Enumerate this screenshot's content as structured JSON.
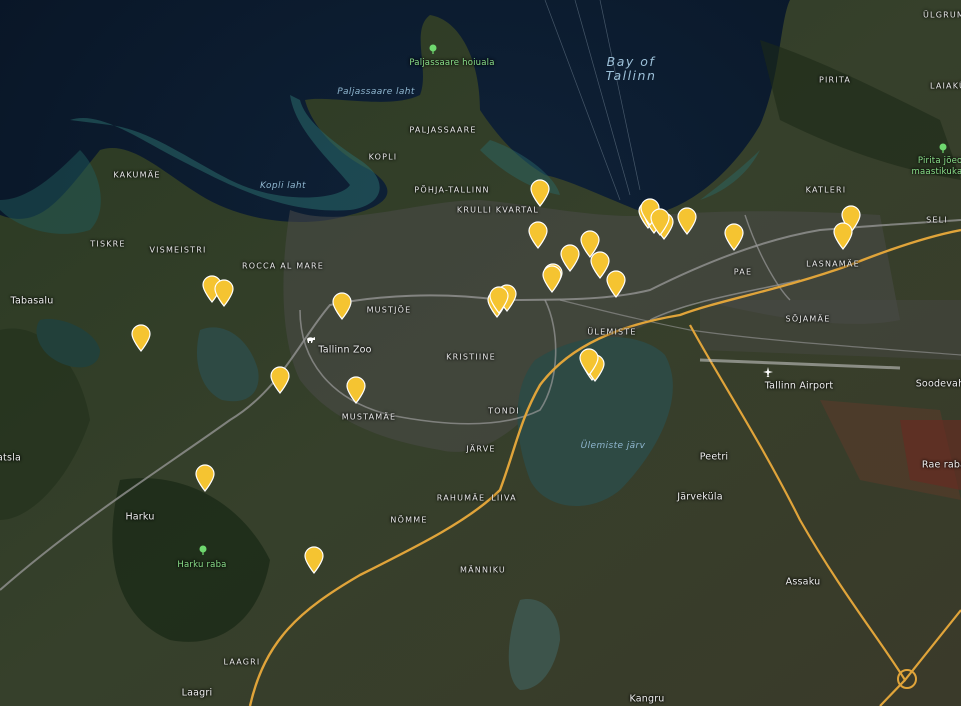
{
  "map": {
    "water_labels": [
      "Paljassaare laht",
      "Kopli laht",
      "Ülemiste järv"
    ],
    "bay_label": [
      "Bay of",
      "Tallinn"
    ],
    "district_labels": [
      "Paljassaare",
      "Kopli",
      "Põhja-Tallinn",
      "Krulli kvartal",
      "Kakumäe",
      "Tiskre",
      "Vismeistri",
      "Rocca al Mare",
      "Mustjõe",
      "Kristiine",
      "Tondi",
      "Mustamäe",
      "Järve",
      "Rahumäe",
      "Liiva",
      "Nõmme",
      "Männiku",
      "Laagri",
      "Ülemiste",
      "Pae",
      "Lasnamäe",
      "Sõjamäe",
      "Katleri",
      "Pirita",
      "Laiakü",
      "Seli",
      "Ülgrum"
    ],
    "place_labels": [
      "Tabasalu",
      "Harku",
      "Laagri",
      "Kangru",
      "Assaku",
      "Peetri",
      "Järveküla",
      "Soodevah",
      "Rae raba",
      "atsla",
      "Tallinn Airport",
      "Tallinn Zoo"
    ],
    "green_labels": [
      "Paljassaare hoiuala",
      "Harku raba",
      "Pirita jõeor",
      "maastikukait"
    ],
    "marker_color": "#f5c431",
    "marker_count": 31
  }
}
